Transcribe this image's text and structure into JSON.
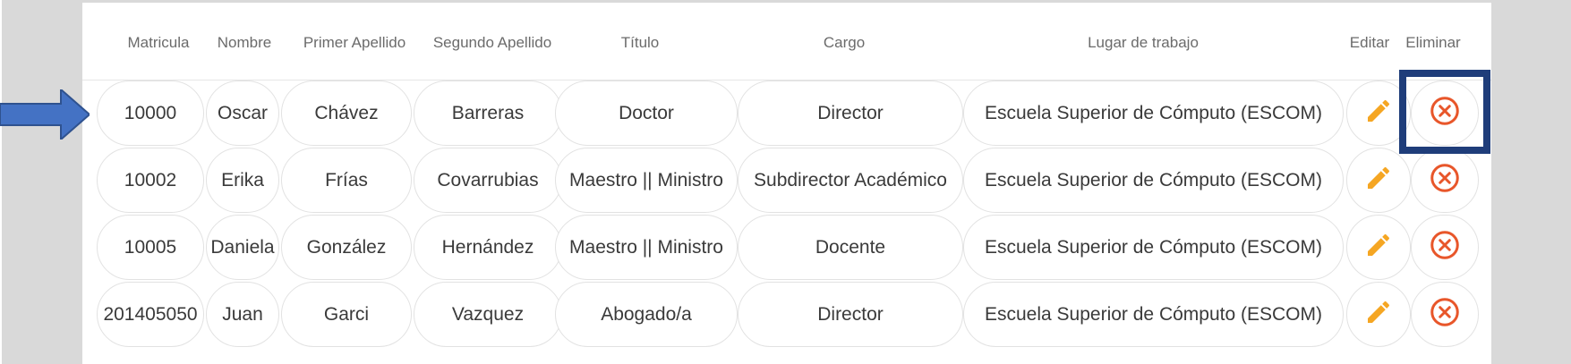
{
  "table": {
    "headers": {
      "matricula": "Matricula",
      "nombre": "Nombre",
      "primer_apellido": "Primer Apellido",
      "segundo_apellido": "Segundo Apellido",
      "titulo": "Título",
      "cargo": "Cargo",
      "lugar": "Lugar de trabajo",
      "editar": "Editar",
      "eliminar": "Eliminar"
    },
    "rows": [
      {
        "matricula": "10000",
        "nombre": "Oscar",
        "primer_apellido": "Chávez",
        "segundo_apellido": "Barreras",
        "titulo": "Doctor",
        "cargo": "Director",
        "lugar": "Escuela Superior de Cómputo (ESCOM)"
      },
      {
        "matricula": "10002",
        "nombre": "Erika",
        "primer_apellido": "Frías",
        "segundo_apellido": "Covarrubias",
        "titulo": "Maestro || Ministro",
        "cargo": "Subdirector Académico",
        "lugar": "Escuela Superior de Cómputo (ESCOM)"
      },
      {
        "matricula": "10005",
        "nombre": "Daniela",
        "primer_apellido": "González",
        "segundo_apellido": "Hernández",
        "titulo": "Maestro || Ministro",
        "cargo": "Docente",
        "lugar": "Escuela Superior de Cómputo (ESCOM)"
      },
      {
        "matricula": "201405050",
        "nombre": "Juan",
        "primer_apellido": "Garci",
        "segundo_apellido": "Vazquez",
        "titulo": "Abogado/a",
        "cargo": "Director",
        "lugar": "Escuela Superior de Cómputo (ESCOM)"
      }
    ]
  },
  "icons": {
    "edit": "pencil-icon",
    "delete": "close-circle-icon",
    "pointer": "arrow-right-icon"
  },
  "colors": {
    "edit_icon": "#f5a623",
    "delete_icon": "#e8562a",
    "annotation": "#1f3d7a",
    "arrow": "#4472c4"
  }
}
